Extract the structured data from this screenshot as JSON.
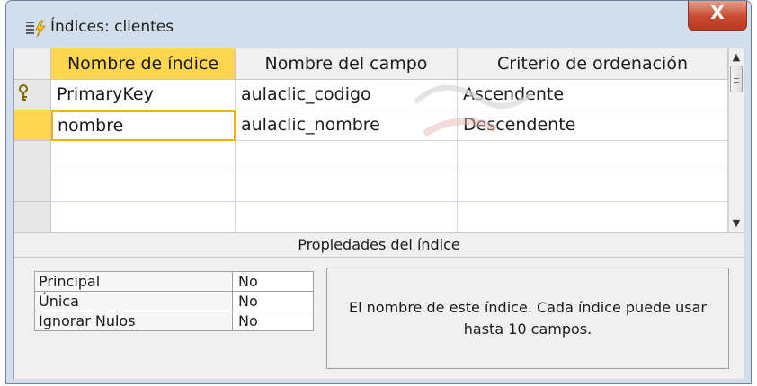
{
  "window": {
    "title": "Índices: clientes",
    "close_label": "X"
  },
  "grid": {
    "headers": [
      "Nombre de índice",
      "Nombre del campo",
      "Criterio de ordenación"
    ],
    "rows": [
      {
        "indicator": "key-icon",
        "cells": [
          "PrimaryKey",
          "aulaclic_codigo",
          "Ascendente"
        ]
      },
      {
        "indicator": "current",
        "cells": [
          "nombre",
          "aulaclic_nombre",
          "Descendente"
        ]
      },
      {
        "indicator": "",
        "cells": [
          "",
          "",
          ""
        ]
      },
      {
        "indicator": "",
        "cells": [
          "",
          "",
          ""
        ]
      },
      {
        "indicator": "",
        "cells": [
          "",
          "",
          ""
        ]
      }
    ]
  },
  "properties": {
    "band_title": "Propiedades del índice",
    "items": [
      {
        "label": "Principal",
        "value": "No"
      },
      {
        "label": "Única",
        "value": "No"
      },
      {
        "label": "Ignorar Nulos",
        "value": "No"
      }
    ],
    "help_text": "El nombre de este índice. Cada índice puede usar hasta 10 campos."
  },
  "colors": {
    "selected_header": "#ffd652",
    "focus_border": "#f0b400",
    "close_button": "#c94a30"
  }
}
